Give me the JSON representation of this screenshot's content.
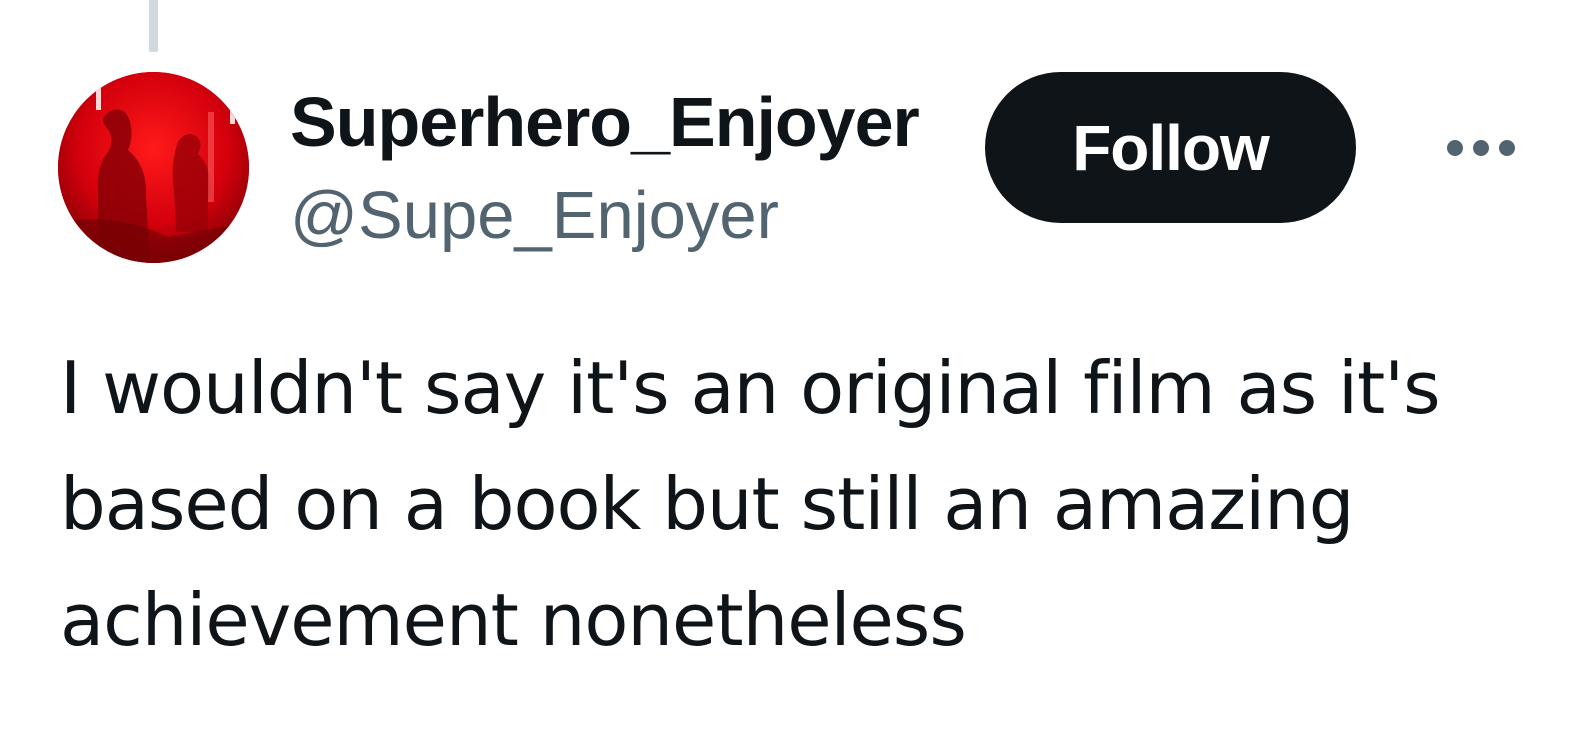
{
  "tweet": {
    "author": {
      "display_name": "Superhero_Enjoyer",
      "handle": "@Supe_Enjoyer",
      "avatar_icon": "user-avatar-image"
    },
    "follow_label": "Follow",
    "more_icon": "more-options-icon",
    "text": "I wouldn't say it's an original film as it's based on a book but still an amazing achievement nonetheless"
  },
  "colors": {
    "primary_text": "#0f1419",
    "secondary_text": "#536471",
    "follow_bg": "#0f1419",
    "follow_text": "#ffffff",
    "thread_line": "#cfd9de",
    "avatar_red": "#c4000a"
  }
}
